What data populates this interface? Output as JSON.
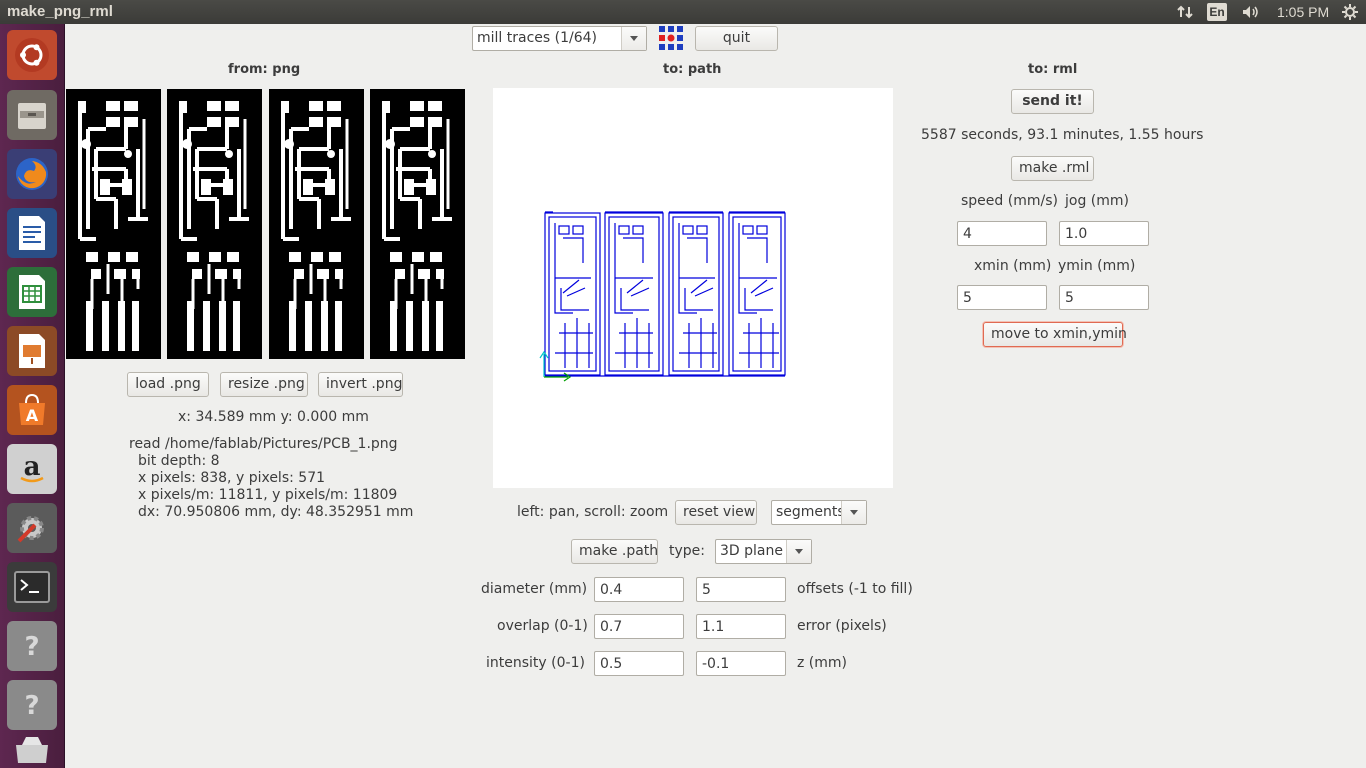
{
  "topbar": {
    "title": "make_png_rml",
    "keyboard_layout": "En",
    "clock": "1:05 PM",
    "icons": [
      "network-icon",
      "keyboard-icon",
      "volume-icon",
      "settings-gear-icon"
    ]
  },
  "launcher": {
    "items": [
      {
        "name": "Ubuntu Dash",
        "icon": "ubuntu-logo-icon"
      },
      {
        "name": "Files",
        "icon": "file-manager-icon"
      },
      {
        "name": "Firefox",
        "icon": "firefox-icon"
      },
      {
        "name": "LibreOffice Writer",
        "icon": "writer-icon"
      },
      {
        "name": "LibreOffice Calc",
        "icon": "calc-icon"
      },
      {
        "name": "LibreOffice Impress",
        "icon": "impress-icon"
      },
      {
        "name": "Ubuntu Software",
        "icon": "software-center-icon"
      },
      {
        "name": "Amazon",
        "icon": "amazon-icon"
      },
      {
        "name": "System Settings",
        "icon": "system-settings-icon"
      },
      {
        "name": "Terminal",
        "icon": "terminal-icon"
      },
      {
        "name": "Unknown application",
        "icon": "unknown-app-icon"
      },
      {
        "name": "Unknown application",
        "icon": "unknown-app-icon"
      },
      {
        "name": "Trash",
        "icon": "trash-icon"
      }
    ]
  },
  "toolbar": {
    "process": "mill traces (1/64)",
    "quit_label": "quit"
  },
  "from_png": {
    "header": "from: png",
    "load_label": "load .png",
    "resize_label": "resize .png",
    "invert_label": "invert .png",
    "coords": "x: 34.589 mm  y: 0.000 mm",
    "info": {
      "line1": "read /home/fablab/Pictures/PCB_1.png",
      "line2": "bit depth: 8",
      "line3": "x pixels: 838, y pixels: 571",
      "line4": "x pixels/m: 11811, y pixels/m: 11809",
      "line5": "dx: 70.950806 mm, dy: 48.352951 mm"
    }
  },
  "to_path": {
    "header": "to: path",
    "view_hint": "left: pan, scroll: zoom",
    "reset_label": "reset view",
    "display_mode": "segments",
    "make_path_label": "make .path",
    "type_label": "type:",
    "type_value": "3D plane",
    "diameter_label": "diameter (mm)",
    "diameter": "0.4",
    "offsets": "5",
    "offsets_label": "offsets (-1 to fill)",
    "overlap_label": "overlap (0-1)",
    "overlap": "0.7",
    "error": "1.1",
    "error_label": "error (pixels)",
    "intensity_label": "intensity (0-1)",
    "intensity": "0.5",
    "z": "-0.1",
    "z_label": "z (mm)"
  },
  "to_rml": {
    "header": "to: rml",
    "send_label": "send it!",
    "time_estimate": "5587 seconds, 93.1 minutes, 1.55 hours",
    "make_rml_label": "make .rml",
    "speed_label": "speed (mm/s)",
    "speed": "4",
    "jog_label": "jog (mm)",
    "jog": "1.0",
    "xmin_label": "xmin (mm)",
    "xmin": "5",
    "ymin_label": "ymin (mm)",
    "ymin": "5",
    "move_label": "move to xmin,ymin"
  },
  "colors": {
    "toolpath": "#0000dd",
    "axis_marker": "#00c8c8",
    "pcb_background": "#000000",
    "pcb_traces": "#ffffff",
    "launcher": "#5e2750",
    "focus_border": "#e06a52"
  }
}
